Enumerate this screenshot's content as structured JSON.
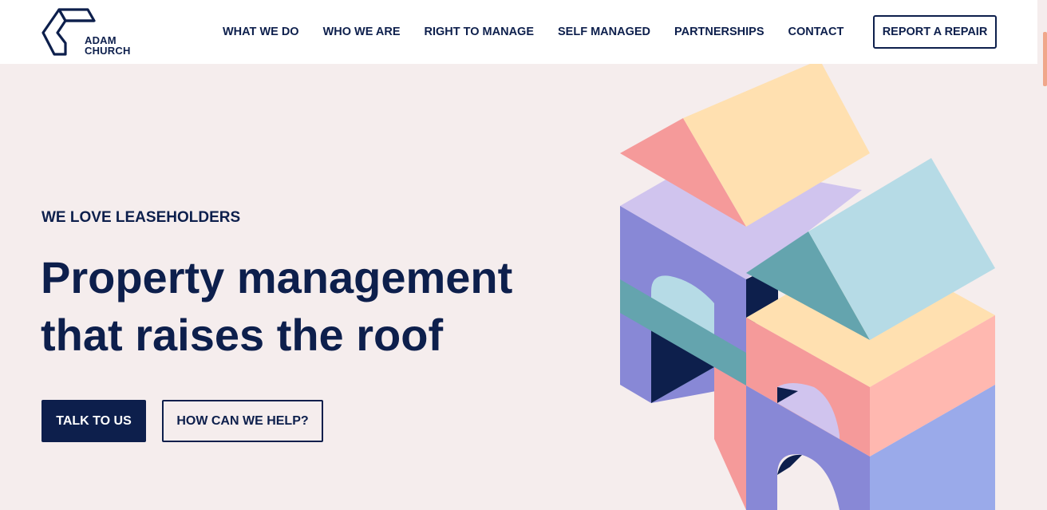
{
  "brand": {
    "line1": "ADAM",
    "line2": "CHURCH"
  },
  "nav": {
    "items": [
      "WHAT WE DO",
      "WHO WE ARE",
      "RIGHT TO MANAGE",
      "SELF MANAGED",
      "PARTNERSHIPS",
      "CONTACT"
    ]
  },
  "header": {
    "repair_label": "REPORT A REPAIR"
  },
  "hero": {
    "eyebrow": "WE LOVE LEASEHOLDERS",
    "headline_line1": "Property management",
    "headline_line2": "that raises the roof",
    "primary_label": "TALK TO US",
    "secondary_label": "HOW CAN WE HELP?"
  },
  "colors": {
    "navy": "#0d1f4c",
    "background": "#f5eded",
    "peach": "#ffe0b0",
    "pink": "#f59a9a",
    "lilac": "#d0c4ee",
    "periwinkle": "#8888d6",
    "teal": "#64a4ae",
    "light_blue": "#b6dbe6"
  }
}
